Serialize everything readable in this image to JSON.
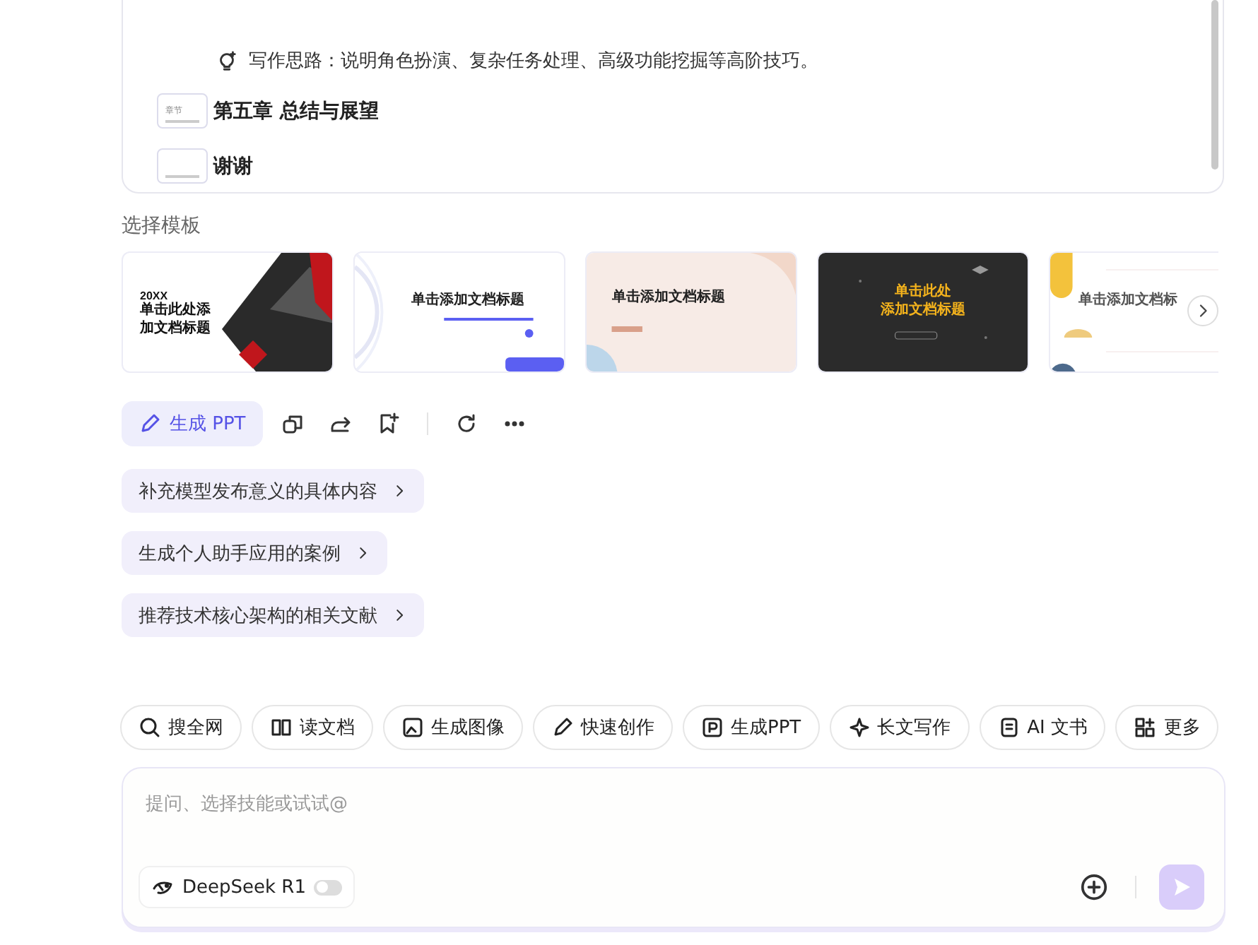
{
  "outline": {
    "tip": "写作思路：说明角色扮演、复杂任务处理、高级功能挖掘等高阶技巧。",
    "chapters": [
      {
        "thumb_label": "章节",
        "title": "第五章 总结与展望"
      },
      {
        "title": "谢谢"
      }
    ]
  },
  "templates": {
    "label": "选择模板",
    "items": [
      {
        "kind": "red",
        "eyebrow": "20XX",
        "title_lines": [
          "单击此处添",
          "加文档标题"
        ]
      },
      {
        "kind": "white",
        "title_lines": [
          "单击添加文档标题"
        ]
      },
      {
        "kind": "peach",
        "title_lines": [
          "单击添加文档标题"
        ]
      },
      {
        "kind": "dark",
        "title_lines": [
          "单击此处",
          "添加文档标题"
        ]
      },
      {
        "kind": "yellow",
        "title_lines": [
          "单击添加文档标"
        ]
      }
    ]
  },
  "actions": {
    "primary": "生成 PPT"
  },
  "suggestions": [
    "补充模型发布意义的具体内容",
    "生成个人助手应用的案例",
    "推荐技术核心架构的相关文献"
  ],
  "tools": [
    {
      "kind": "search",
      "label": "搜全网"
    },
    {
      "kind": "read",
      "label": "读文档"
    },
    {
      "kind": "image",
      "label": "生成图像"
    },
    {
      "kind": "pen",
      "label": "快速创作"
    },
    {
      "kind": "ppt",
      "label": "生成PPT"
    },
    {
      "kind": "sparkle",
      "label": "长文写作"
    },
    {
      "kind": "book",
      "label": "AI 文书"
    },
    {
      "kind": "grid",
      "label": "更多"
    }
  ],
  "composer": {
    "placeholder": "提问、选择技能或试试@",
    "model": "DeepSeek R1",
    "model_on": false
  }
}
